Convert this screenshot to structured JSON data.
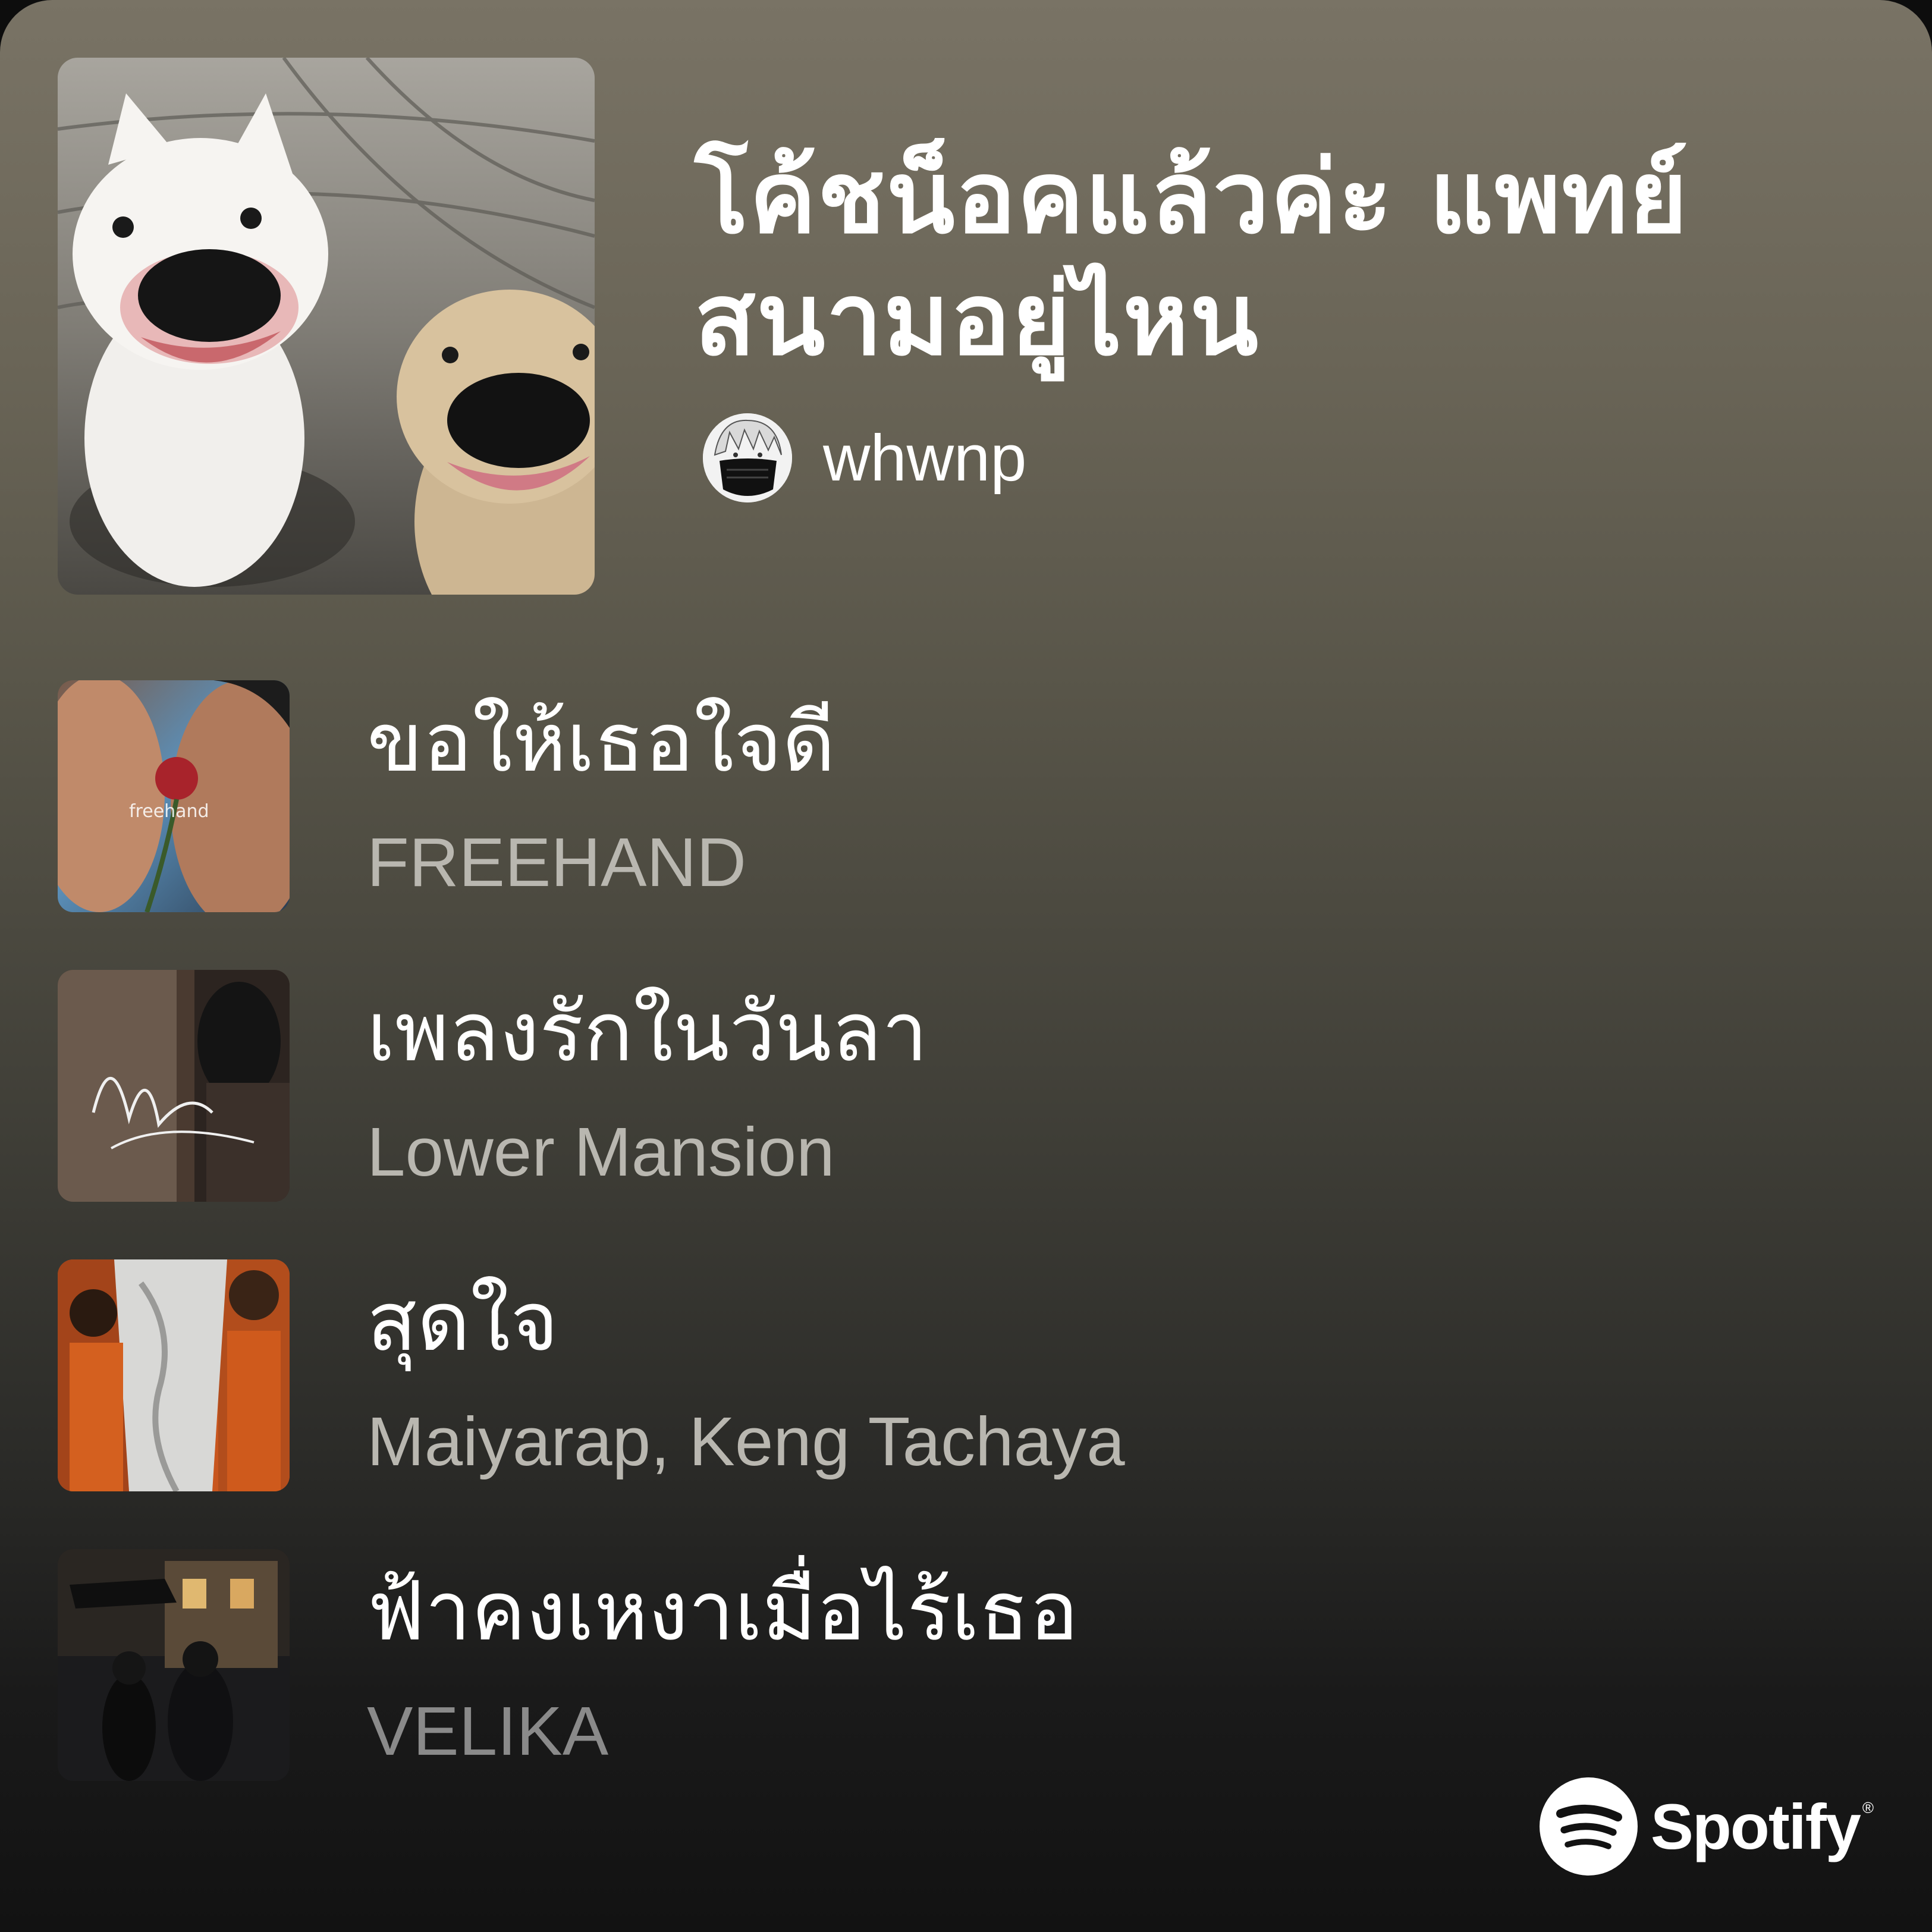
{
  "playlist": {
    "title_line1": "โค้ชน็อคแล้วค่ะ แพทย์",
    "title_line2": "สนามอยู่ไหน",
    "owner": "whwnp"
  },
  "tracks": [
    {
      "title": "ขอให้เธอใจดี",
      "artist": "FREEHAND",
      "art_icon": "album-cover-freehand"
    },
    {
      "title": "เพลงรักในวันลา",
      "artist": "Lower Mansion",
      "art_icon": "album-cover-lower-mansion"
    },
    {
      "title": "สุดใจ",
      "artist": "Maiyarap, Keng Tachaya",
      "art_icon": "album-cover-maiyarap"
    },
    {
      "title": "ฟ้าคงเหงาเมื่อไร้เธอ",
      "artist": "VELIKA",
      "art_icon": "album-cover-velika"
    }
  ],
  "branding": {
    "logo_text": "Spotify",
    "trademark": "®",
    "icon": "spotify-icon"
  }
}
